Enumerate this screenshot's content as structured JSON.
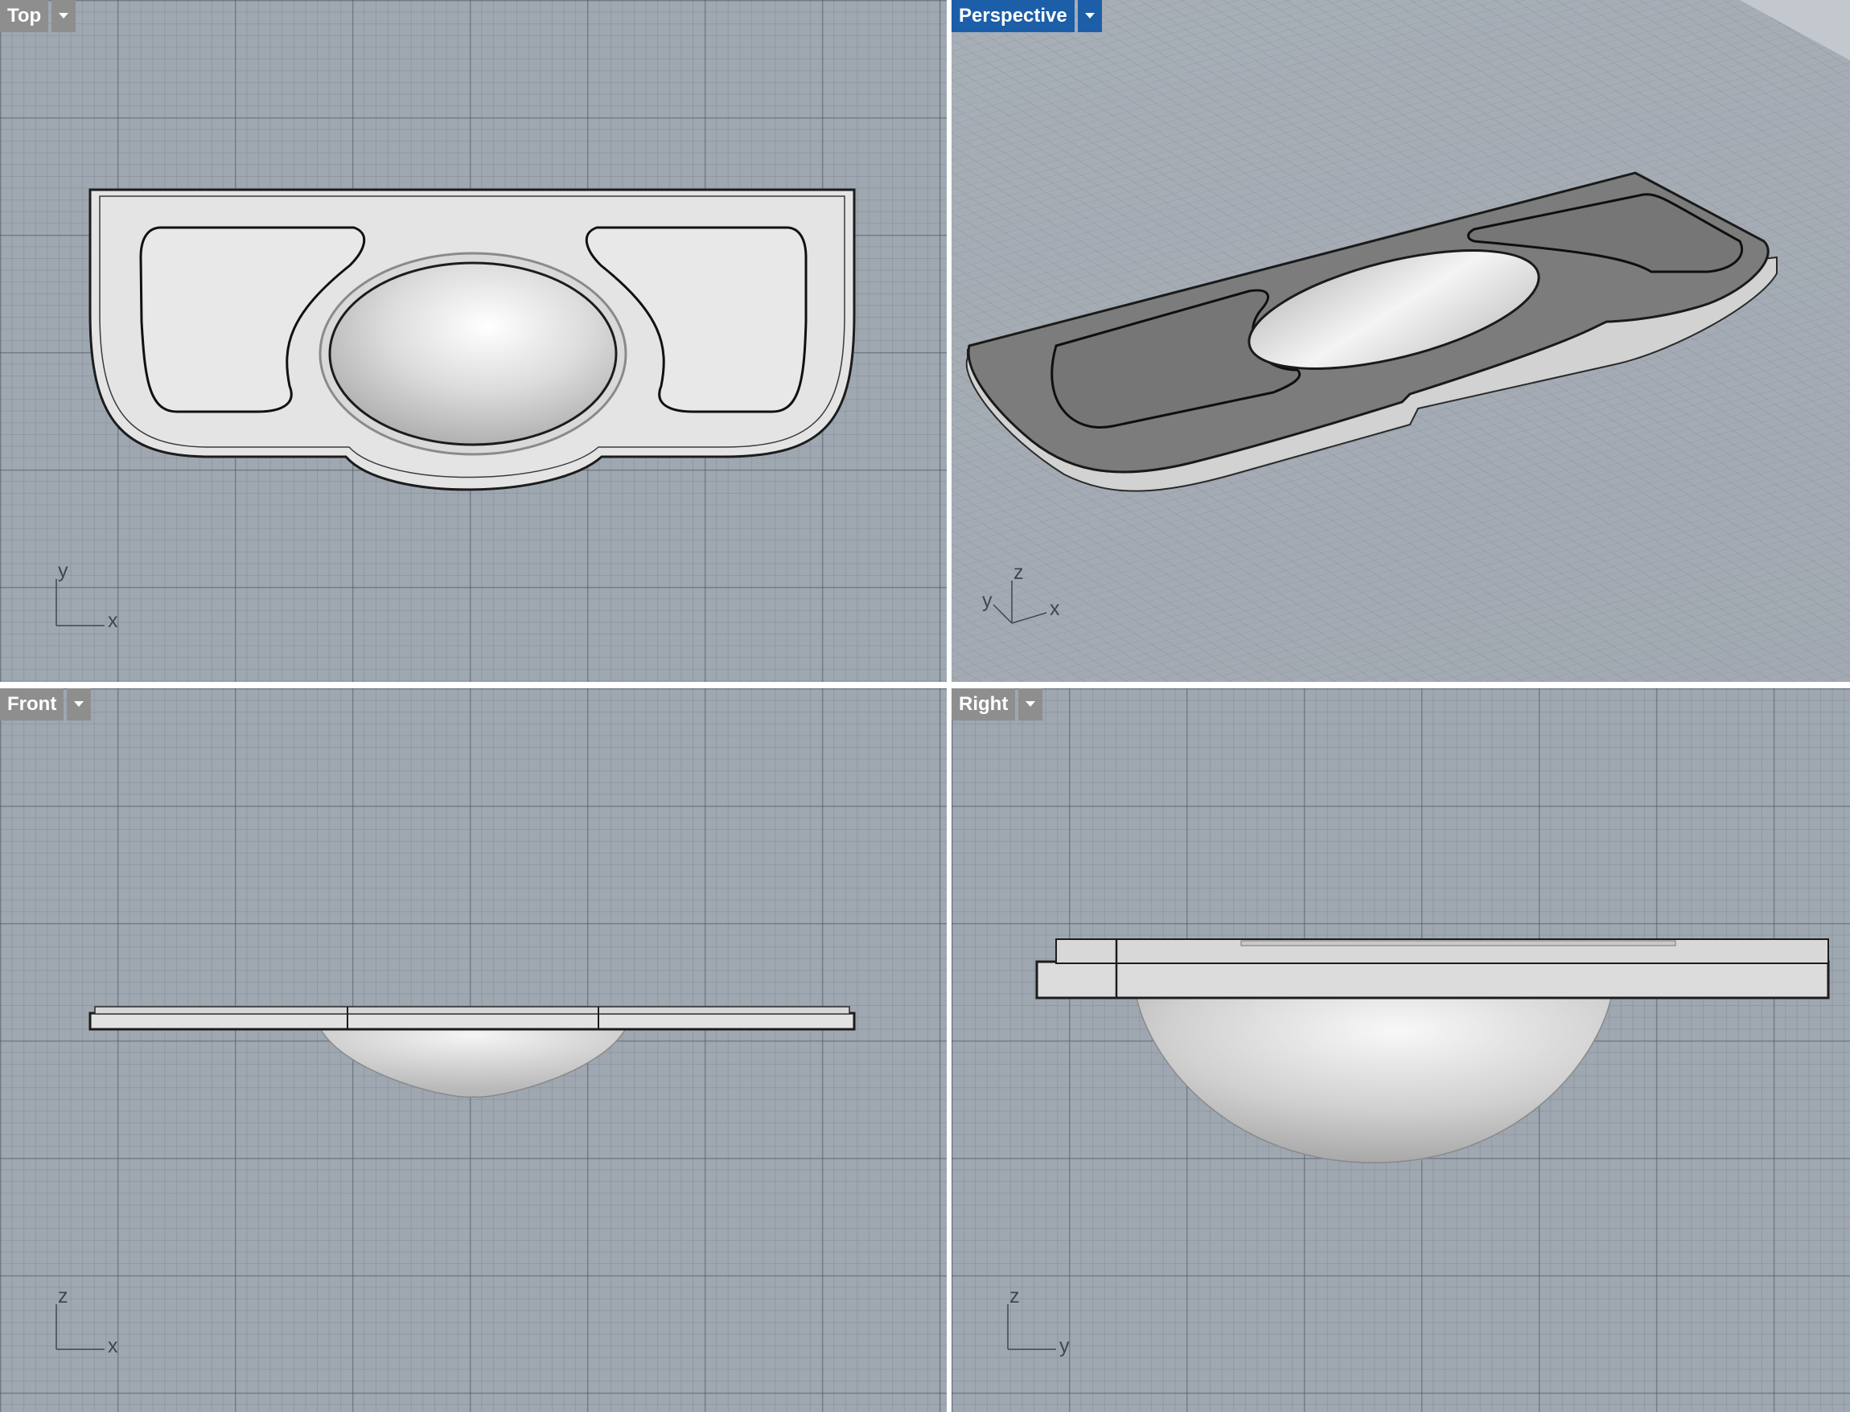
{
  "colors": {
    "viewport_bg": "#9fa7b1",
    "active_tab": "#1c5ea7",
    "inactive_tab": "#8e8e8e",
    "model_surface": "#e6e6e6",
    "perspective_top": "#7d7d7d"
  },
  "viewports": {
    "top": {
      "label": "Top",
      "axis_v": "y",
      "axis_h": "x",
      "active": false
    },
    "perspective": {
      "label": "Perspective",
      "axis_z": "z",
      "axis_y": "y",
      "axis_x": "x",
      "active": true
    },
    "front": {
      "label": "Front",
      "axis_v": "z",
      "axis_h": "x",
      "active": false
    },
    "right": {
      "label": "Right",
      "axis_v": "z",
      "axis_h": "y",
      "active": false
    }
  },
  "icons": {
    "viewport_menu": "chevron-down-icon"
  }
}
